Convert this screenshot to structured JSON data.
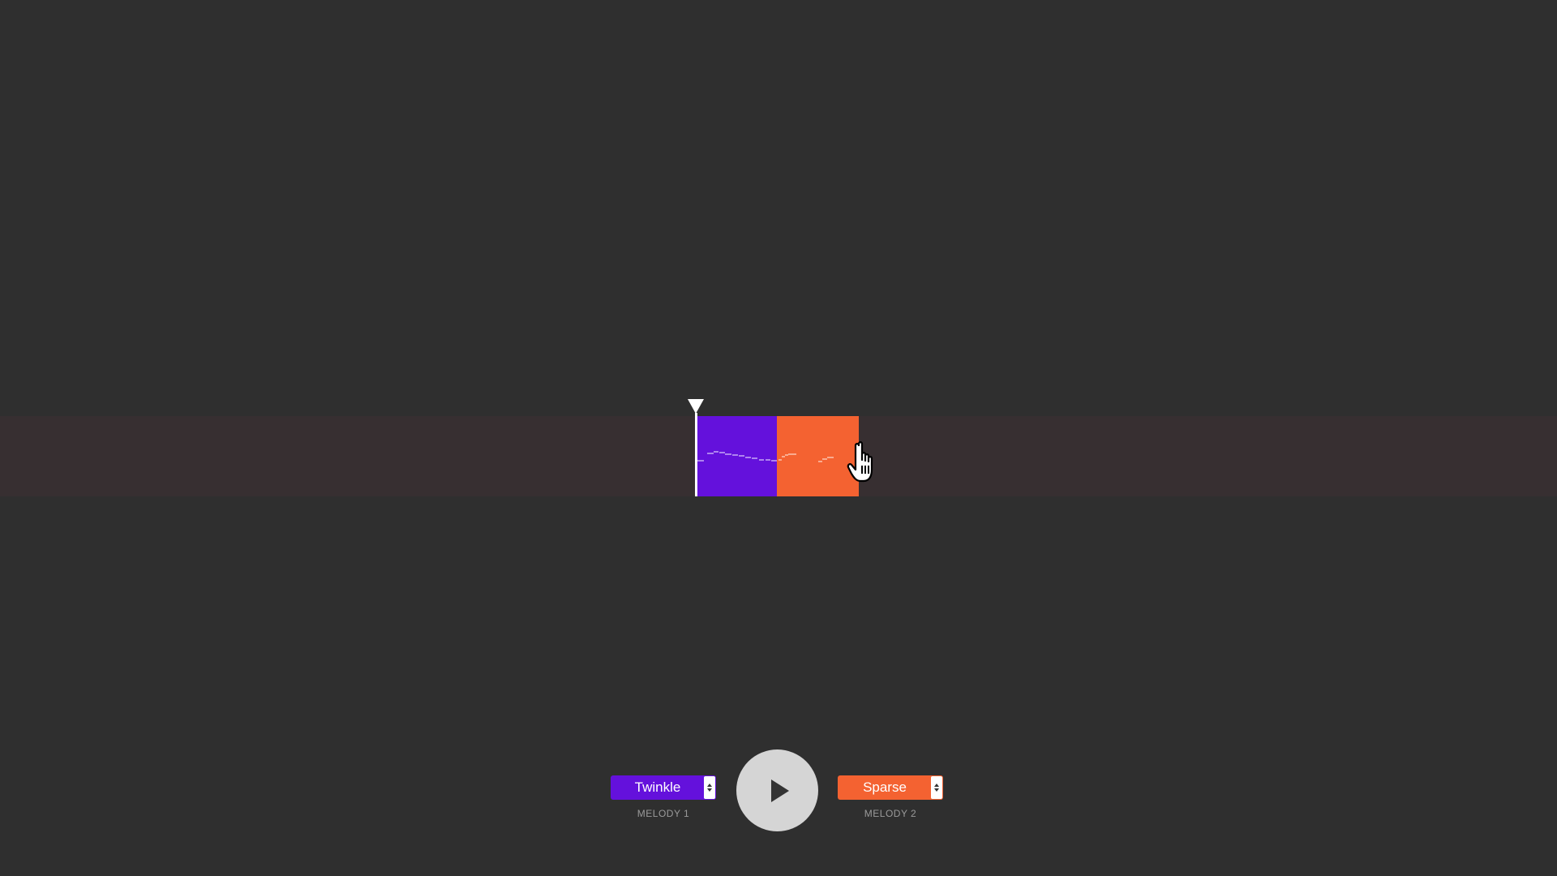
{
  "colors": {
    "background": "#2f2f2f",
    "track": "#372f31",
    "melody_1": "#6411dc",
    "melody_2": "#f46231",
    "play_button": "#d5d5d5"
  },
  "timeline": {
    "blocks": [
      {
        "melody": "melody_1",
        "color": "#6411dc"
      },
      {
        "melody": "melody_2",
        "color": "#f46231"
      }
    ],
    "playhead_icon": "triangle-down-icon",
    "cursor_icon": "hand-pointer-icon"
  },
  "controls": {
    "melody_1": {
      "selected": "Twinkle",
      "label": "MELODY 1",
      "color": "#6411dc"
    },
    "melody_2": {
      "selected": "Sparse",
      "label": "MELODY 2",
      "color": "#f46231"
    },
    "play_icon": "play-icon"
  }
}
